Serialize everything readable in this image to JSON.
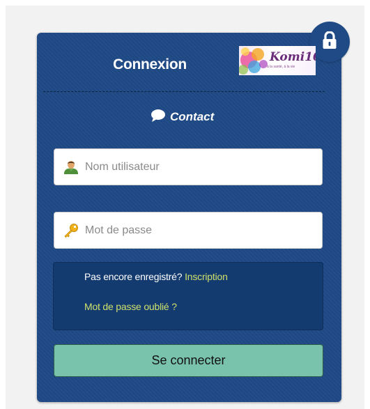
{
  "login": {
    "title": "Connexion",
    "logo_text": "Komi10",
    "logo_tagline": "à la santé, à la vie",
    "contact_label": "Contact",
    "username_placeholder": "Nom utilisateur",
    "username_value": "",
    "password_placeholder": "Mot de passe",
    "password_value": "",
    "not_registered_text": "Pas encore enregistré?",
    "signup_link": "Inscription",
    "forgot_password_link": "Mot de passe oublié ?",
    "submit_label": "Se connecter"
  },
  "icons": {
    "lock": "lock-icon",
    "contact": "speech-bubble-icon",
    "user": "user-icon",
    "key": "key-icon"
  },
  "colors": {
    "panel": "#1f4a86",
    "info_box": "#133b70",
    "link": "#cfe06a",
    "submit": "#79c2ac"
  }
}
